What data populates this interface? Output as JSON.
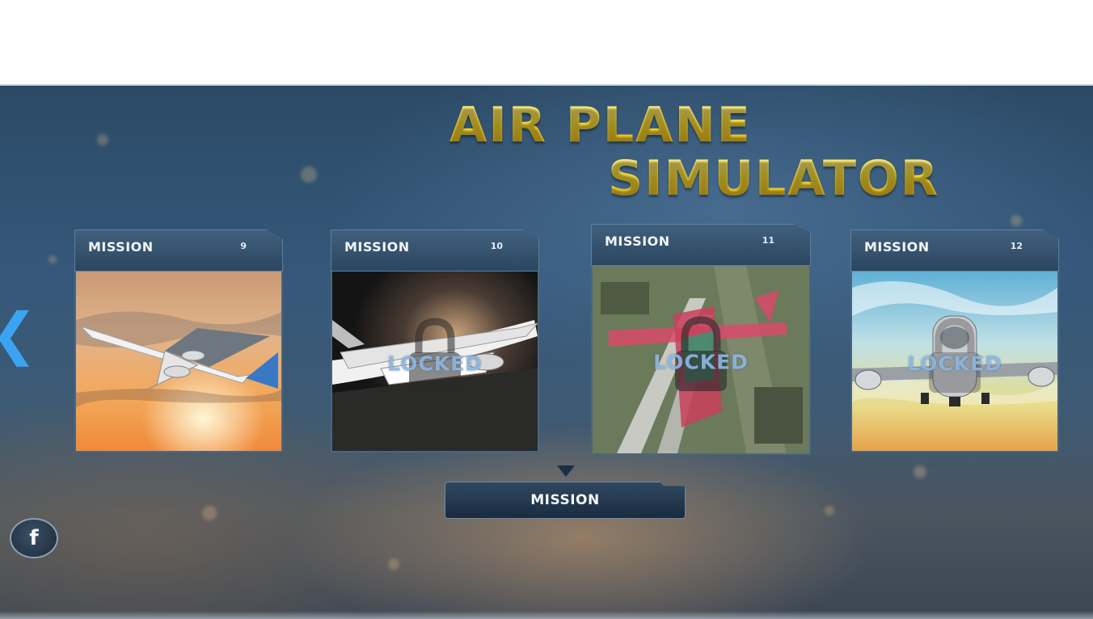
{
  "title": {
    "line1": "AIR PLANE",
    "line2": "SIMULATOR"
  },
  "missions": [
    {
      "label": "MISSION",
      "number": "9",
      "locked": false,
      "lock_text": ""
    },
    {
      "label": "MISSION",
      "number": "10",
      "locked": true,
      "lock_text": "LOCKED"
    },
    {
      "label": "MISSION",
      "number": "11",
      "locked": true,
      "lock_text": "LOCKED"
    },
    {
      "label": "MISSION",
      "number": "12",
      "locked": true,
      "lock_text": "LOCKED"
    }
  ],
  "mission_button": {
    "label": "MISSION"
  },
  "nav": {
    "prev_glyph": "❮"
  },
  "social": {
    "facebook_glyph": "f"
  },
  "colors": {
    "title_gold": "#f7d326",
    "accent_blue": "#3ba3f0",
    "panel_dark": "#2c4660"
  }
}
